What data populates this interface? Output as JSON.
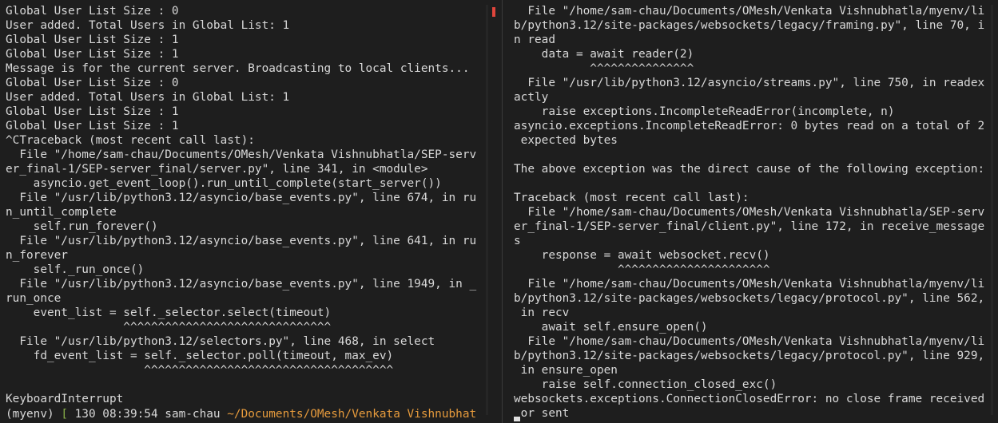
{
  "left_pane": {
    "lines": [
      "Global User List Size : 0",
      "User added. Total Users in Global List: 1",
      "Global User List Size : 1",
      "Global User List Size : 1",
      "Message is for the current server. Broadcasting to local clients...",
      "Global User List Size : 0",
      "User added. Total Users in Global List: 1",
      "Global User List Size : 1",
      "Global User List Size : 1",
      "^CTraceback (most recent call last):",
      "  File \"/home/sam-chau/Documents/OMesh/Venkata Vishnubhatla/SEP-serv",
      "er_final-1/SEP-server_final/server.py\", line 341, in <module>",
      "    asyncio.get_event_loop().run_until_complete(start_server())",
      "  File \"/usr/lib/python3.12/asyncio/base_events.py\", line 674, in ru",
      "n_until_complete",
      "    self.run_forever()",
      "  File \"/usr/lib/python3.12/asyncio/base_events.py\", line 641, in ru",
      "n_forever",
      "    self._run_once()",
      "  File \"/usr/lib/python3.12/asyncio/base_events.py\", line 1949, in _",
      "run_once",
      "    event_list = self._selector.select(timeout)",
      "                 ^^^^^^^^^^^^^^^^^^^^^^^^^^^^^^",
      "  File \"/usr/lib/python3.12/selectors.py\", line 468, in select",
      "    fd_event_list = self._selector.poll(timeout, max_ev)",
      "                    ^^^^^^^^^^^^^^^^^^^^^^^^^^^^^^^^^^^^",
      "",
      "KeyboardInterrupt",
      ""
    ],
    "prompt": {
      "env": "(myenv) ",
      "bracket_open": "[ ",
      "exit_code": "130 ",
      "time": "08:39:54 ",
      "user": "sam-chau ",
      "path": "~/Documents/OMesh/Venkata Vishnubhat"
    }
  },
  "right_pane": {
    "lines": [
      "  File \"/home/sam-chau/Documents/OMesh/Venkata Vishnubhatla/myenv/li",
      "b/python3.12/site-packages/websockets/legacy/framing.py\", line 70, i",
      "n read",
      "    data = await reader(2)",
      "           ^^^^^^^^^^^^^^^",
      "  File \"/usr/lib/python3.12/asyncio/streams.py\", line 750, in readex",
      "actly",
      "    raise exceptions.IncompleteReadError(incomplete, n)",
      "asyncio.exceptions.IncompleteReadError: 0 bytes read on a total of 2",
      " expected bytes",
      "",
      "The above exception was the direct cause of the following exception:",
      "",
      "Traceback (most recent call last):",
      "  File \"/home/sam-chau/Documents/OMesh/Venkata Vishnubhatla/SEP-serv",
      "er_final-1/SEP-server_final/client.py\", line 172, in receive_message",
      "s",
      "    response = await websocket.recv()",
      "               ^^^^^^^^^^^^^^^^^^^^^^",
      "  File \"/home/sam-chau/Documents/OMesh/Venkata Vishnubhatla/myenv/li",
      "b/python3.12/site-packages/websockets/legacy/protocol.py\", line 562,",
      " in recv",
      "    await self.ensure_open()",
      "  File \"/home/sam-chau/Documents/OMesh/Venkata Vishnubhatla/myenv/li",
      "b/python3.12/site-packages/websockets/legacy/protocol.py\", line 929,",
      " in ensure_open",
      "    raise self.connection_closed_exc()",
      "websockets.exceptions.ConnectionClosedError: no close frame received",
      " or sent"
    ]
  },
  "colors": {
    "background": "#1e1e1e",
    "text": "#d8d8d8",
    "prompt_bracket": "#8ab24a",
    "prompt_path": "#e59a3c",
    "scroll_marker": "#e0453c"
  }
}
